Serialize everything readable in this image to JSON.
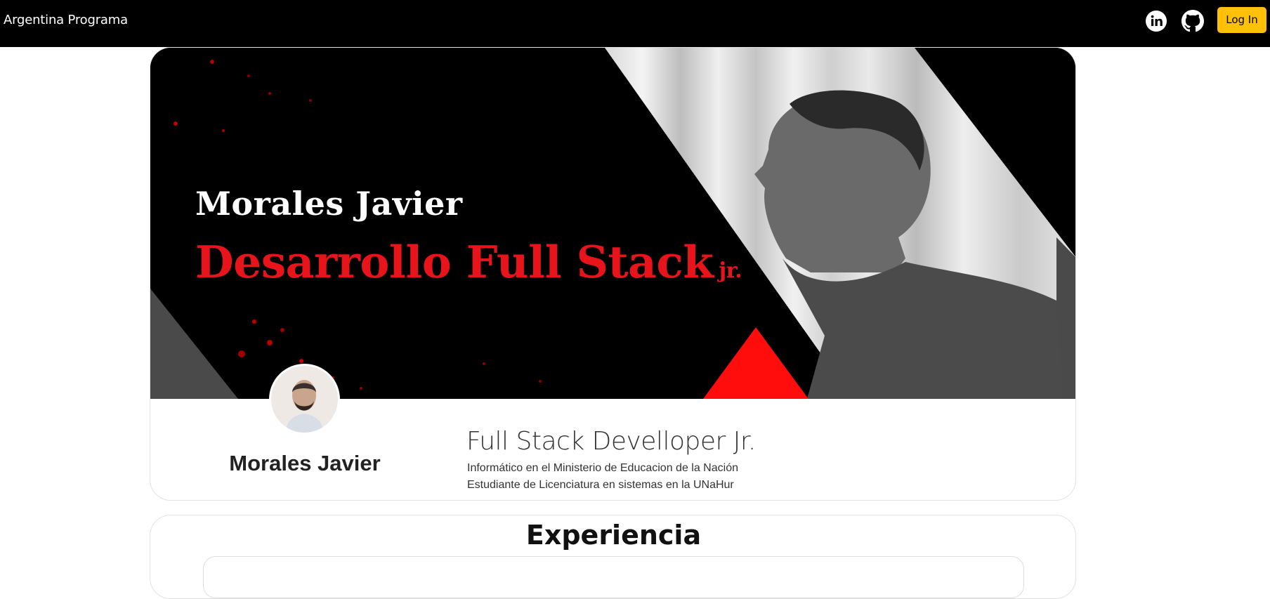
{
  "navbar": {
    "brand": "Argentina Programa",
    "icons": [
      "linkedin-icon",
      "github-icon"
    ],
    "login_label": "Log In",
    "login_color": "#ffc107"
  },
  "banner": {
    "name": "Morales Javier",
    "role": "Desarrollo Full Stack",
    "role_suffix": "jr.",
    "accent_color": "#e8141b"
  },
  "profile": {
    "name": "Morales Javier",
    "title": "Full Stack Develloper Jr.",
    "lines": [
      "Informático en el Ministerio de Educacion de la Nación",
      "Estudiante de Licenciatura en sistemas en la UNaHur"
    ]
  },
  "experience": {
    "title": "Experiencia"
  }
}
